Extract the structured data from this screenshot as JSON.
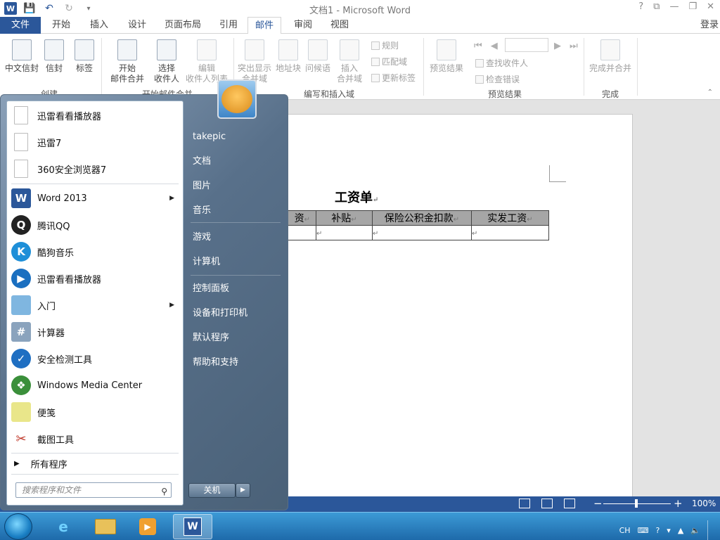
{
  "window": {
    "title": "文档1 - Microsoft Word",
    "controls": [
      "?",
      "⧉",
      "—",
      "❐",
      "✕"
    ]
  },
  "qat": {
    "icons": [
      "word-logo",
      "save-icon",
      "undo-icon",
      "redo-icon",
      "customize-icon"
    ]
  },
  "tabs": {
    "file": "文件",
    "items": [
      "开始",
      "插入",
      "设计",
      "页面布局",
      "引用",
      "邮件",
      "审阅",
      "视图"
    ],
    "active": "邮件",
    "signin": "登录"
  },
  "ribbon": {
    "groups": {
      "create": "创建",
      "start_merge": "开始邮件合并",
      "write_insert": "编写和插入域",
      "preview": "预览结果",
      "finish": "完成"
    },
    "buttons": {
      "chinese_envelope": "中文信封",
      "envelope": "信封",
      "labels": "标签",
      "start_merge_1": "开始",
      "start_merge_2": "邮件合并",
      "select_1": "选择",
      "select_2": "收件人",
      "edit_1": "编辑",
      "edit_2": "收件人列表",
      "highlight_1": "突出显示",
      "highlight_2": "合并域",
      "address_block": "地址块",
      "greeting": "问候语",
      "insert_1": "插入",
      "insert_2": "合并域",
      "rules": "规则",
      "match_fields": "匹配域",
      "update_labels": "更新标签",
      "preview_results": "预览结果",
      "find_recipient": "查找收件人",
      "check_errors": "检查错误",
      "finish_merge": "完成并合并"
    }
  },
  "document": {
    "heading": "工资单",
    "table_headers": [
      "资",
      "补贴",
      "保险公积金扣款",
      "实发工资"
    ],
    "para_mark": "↵"
  },
  "statusbar": {
    "zoom": "100%"
  },
  "start_menu": {
    "programs": [
      {
        "label": "迅雷看看播放器",
        "icon": "document-icon",
        "arrow": false
      },
      {
        "label": "迅雷7",
        "icon": "document-icon",
        "arrow": false
      },
      {
        "label": "360安全浏览器7",
        "icon": "document-icon",
        "arrow": false
      },
      {
        "label": "Word 2013",
        "icon": "word-icon",
        "arrow": true
      },
      {
        "label": "腾讯QQ",
        "icon": "qq-icon",
        "arrow": false
      },
      {
        "label": "酷狗音乐",
        "icon": "kugou-icon",
        "arrow": false
      },
      {
        "label": "迅雷看看播放器",
        "icon": "xunlei-player-icon",
        "arrow": false
      },
      {
        "label": "入门",
        "icon": "getting-started-icon",
        "arrow": true
      },
      {
        "label": "计算器",
        "icon": "calculator-icon",
        "arrow": false
      },
      {
        "label": "安全检测工具",
        "icon": "security-tool-icon",
        "arrow": false
      },
      {
        "label": "Windows Media Center",
        "icon": "media-center-icon",
        "arrow": false
      },
      {
        "label": "便笺",
        "icon": "sticky-notes-icon",
        "arrow": false
      },
      {
        "label": "截图工具",
        "icon": "snipping-tool-icon",
        "arrow": false
      }
    ],
    "all_programs": "所有程序",
    "search_placeholder": "搜索程序和文件",
    "places": [
      "takepic",
      "文档",
      "图片",
      "音乐",
      "游戏",
      "计算机",
      "控制面板",
      "设备和打印机",
      "默认程序",
      "帮助和支持"
    ],
    "shutdown": "关机"
  },
  "taskbar": {
    "tray": {
      "language": "CH"
    }
  }
}
